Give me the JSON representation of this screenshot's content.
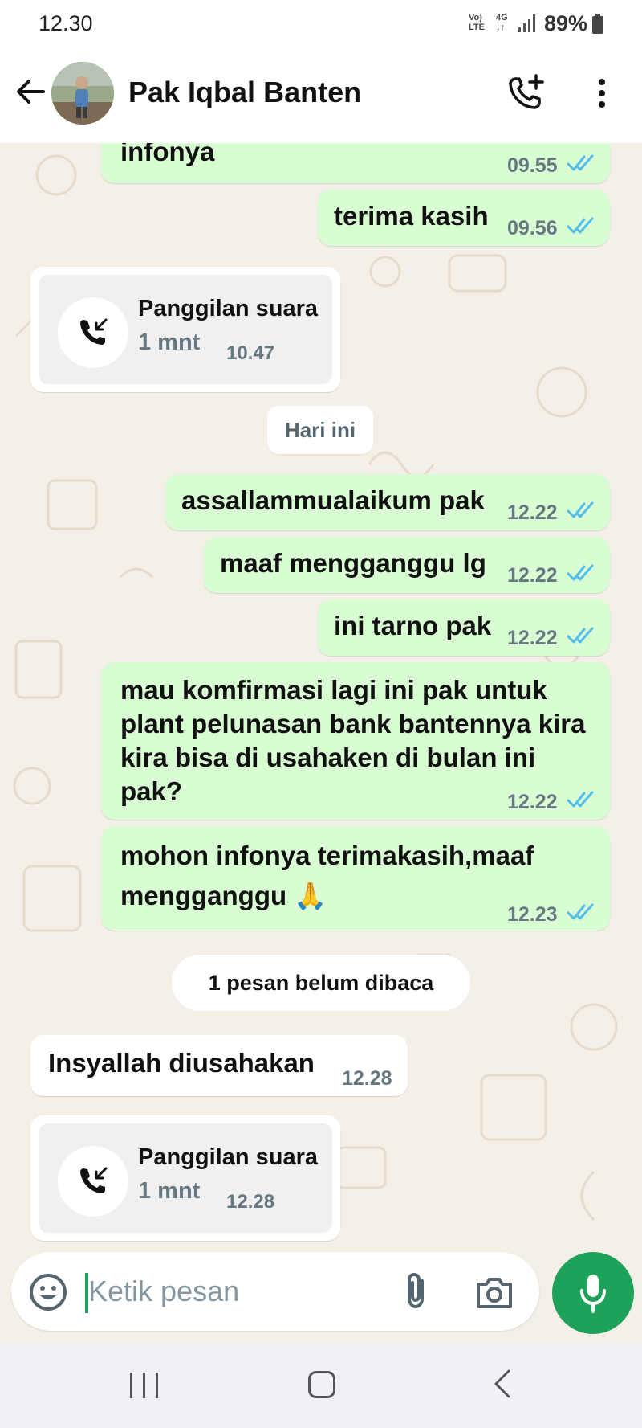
{
  "status_bar": {
    "time": "12.30",
    "signal_top": "Vo)",
    "signal_bottom": "LTE",
    "network_top": "4G",
    "network_bottom": "↓↑",
    "battery": "89%"
  },
  "header": {
    "contact_name": "Pak Iqbal Banten"
  },
  "messages": [
    {
      "text": "infonya",
      "time": "09.55"
    },
    {
      "text": "terima kasih",
      "time": "09.56"
    },
    {
      "text": "assallammualaikum pak",
      "time": "12.22"
    },
    {
      "text": "maaf mengganggu lg",
      "time": "12.22"
    },
    {
      "text": "ini tarno pak",
      "time": "12.22"
    },
    {
      "text": "mau komfirmasi lagi ini pak untuk plant pelunasan bank bantennya kira kira bisa di usahaken di bulan ini pak?",
      "time": "12.22"
    },
    {
      "text": "mohon infonya terimakasih,maaf mengganggu 🙏",
      "time": "12.23"
    },
    {
      "text": "Insyallah diusahakan",
      "time": "12.28"
    }
  ],
  "calls": [
    {
      "title": "Panggilan suara",
      "duration": "1 mnt",
      "time": "10.47"
    },
    {
      "title": "Panggilan suara",
      "duration": "1 mnt",
      "time": "12.28"
    }
  ],
  "date_divider": "Hari ini",
  "unread_banner": "1 pesan belum dibaca",
  "composer": {
    "placeholder": "Ketik pesan"
  },
  "colors": {
    "outgoing_bubble": "#d9fdd3",
    "incoming_bubble": "#ffffff",
    "accent_green": "#1ea158",
    "read_ticks": "#53bdeb",
    "chat_background": "#f4efe7"
  }
}
